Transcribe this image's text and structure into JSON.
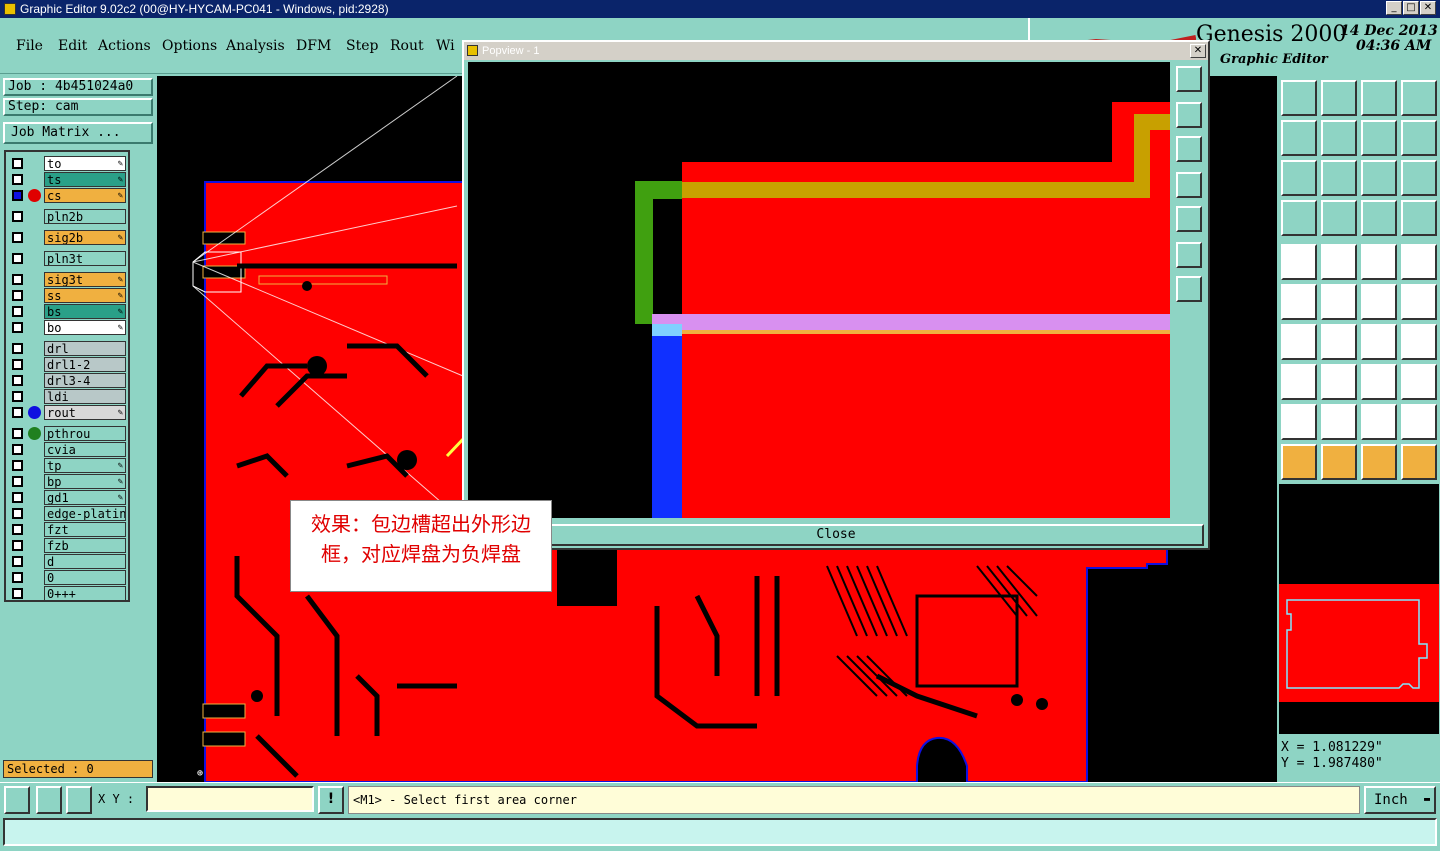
{
  "window": {
    "title": "Graphic Editor 9.02c2 (00@HY-HYCAM-PC041 - Windows, pid:2928)"
  },
  "menu": [
    "File",
    "Edit",
    "Actions",
    "Options",
    "Analysis",
    "DFM",
    "Step",
    "Rout",
    "Wi"
  ],
  "logo": {
    "product": "Genesis 2000",
    "subtitle": "Graphic Editor",
    "date": "14 Dec 2013",
    "time": "04:36 AM"
  },
  "job": {
    "label": "Job : 4b451024a0",
    "step": "Step: cam",
    "matrix_button": "Job Matrix ..."
  },
  "layers": [
    {
      "name": "to",
      "bg": "#ffffff",
      "dot": null
    },
    {
      "name": "ts",
      "bg": "#2aa088",
      "dot": null
    },
    {
      "name": "cs",
      "bg": "#f0b040",
      "dot": "#e00000",
      "active": true
    },
    {
      "name": "pln2b",
      "bg": "#8ed4c4",
      "dot": null
    },
    {
      "name": "sig2b",
      "bg": "#f0b040",
      "dot": null
    },
    {
      "name": "pln3t",
      "bg": "#8ed4c4",
      "dot": null
    },
    {
      "name": "sig3t",
      "bg": "#f0b040",
      "dot": null
    },
    {
      "name": "ss",
      "bg": "#f0b040",
      "dot": null
    },
    {
      "name": "bs",
      "bg": "#2aa088",
      "dot": null
    },
    {
      "name": "bo",
      "bg": "#ffffff",
      "dot": null
    },
    {
      "name": "drl",
      "bg": "#b8c8c8",
      "dot": null
    },
    {
      "name": "drl1-2",
      "bg": "#b8c8c8",
      "dot": null
    },
    {
      "name": "drl3-4",
      "bg": "#b8c8c8",
      "dot": null
    },
    {
      "name": "ldi",
      "bg": "#b8c8c8",
      "dot": null
    },
    {
      "name": "rout",
      "bg": "#d8d8d8",
      "dot": "#1010e0"
    },
    {
      "name": "pthrou",
      "bg": "#8ed4c4",
      "dot": "#208020"
    },
    {
      "name": "cvia",
      "bg": "#8ed4c4",
      "dot": null
    },
    {
      "name": "tp",
      "bg": "#8ed4c4",
      "dot": null
    },
    {
      "name": "bp",
      "bg": "#8ed4c4",
      "dot": null
    },
    {
      "name": "gd1",
      "bg": "#8ed4c4",
      "dot": null
    },
    {
      "name": "edge-plating",
      "bg": "#8ed4c4",
      "dot": null
    },
    {
      "name": "fzt",
      "bg": "#8ed4c4",
      "dot": null
    },
    {
      "name": "fzb",
      "bg": "#8ed4c4",
      "dot": null
    },
    {
      "name": "d",
      "bg": "#8ed4c4",
      "dot": null
    },
    {
      "name": "0",
      "bg": "#8ed4c4",
      "dot": null
    },
    {
      "name": "0+++",
      "bg": "#8ed4c4",
      "dot": null
    }
  ],
  "selected": "Selected : 0",
  "popup": {
    "title": "Popview - 1",
    "close": "Close"
  },
  "annotation": {
    "line1": "效果：包边槽超出外形边",
    "line2": "框，对应焊盘为负焊盘"
  },
  "coords": {
    "x": "X = 1.081229\"",
    "y": "Y = 1.987480\""
  },
  "bottom": {
    "xy_label": "X Y :",
    "message": "<M1> - Select first area corner",
    "unit": "Inch"
  },
  "colors": {
    "copper": "#ff0000",
    "board_outline": "#1010e0",
    "panel": "#8ed4c4",
    "highlight": "#f0b040"
  }
}
